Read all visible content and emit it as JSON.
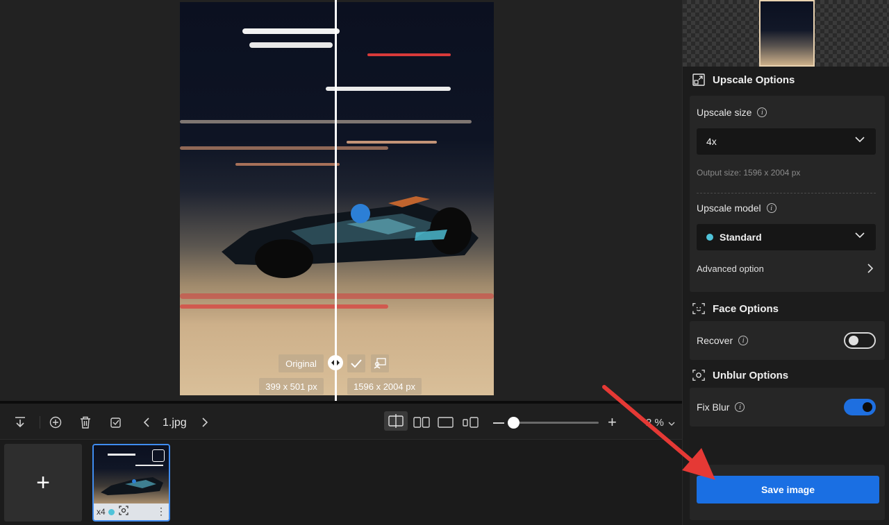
{
  "preview": {
    "compare_label": "Original",
    "original_size": "399 x 501 px",
    "upscaled_size": "1596 x 2004 px"
  },
  "toolbar": {
    "filename": "1.jpg",
    "zoom_value": "2 %",
    "zoom_level": 0.05
  },
  "thumbnail": {
    "scale_label": "x4"
  },
  "panel": {
    "upscale_options_title": "Upscale Options",
    "upscale_size_label": "Upscale size",
    "upscale_size_value": "4x",
    "output_size": "Output size: 1596 x 2004 px",
    "upscale_model_label": "Upscale model",
    "upscale_model_value": "Standard",
    "advanced_option_label": "Advanced option",
    "face_options_title": "Face Options",
    "recover_label": "Recover",
    "recover_enabled": false,
    "unblur_options_title": "Unblur Options",
    "fix_blur_label": "Fix Blur",
    "fix_blur_enabled": true,
    "save_button_label": "Save image"
  },
  "colors": {
    "accent": "#1a6fe3",
    "model_dot": "#4fc3d9",
    "arrow": "#e53935"
  }
}
